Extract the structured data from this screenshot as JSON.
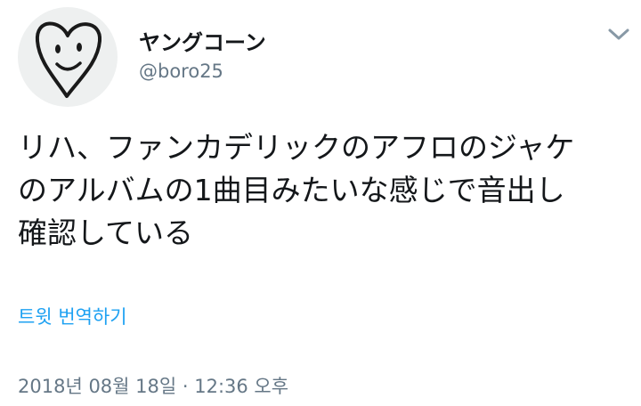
{
  "user": {
    "display_name": "ヤングコーン",
    "handle": "@boro25",
    "avatar_icon": "heart-face-avatar-icon"
  },
  "menu": {
    "icon": "chevron-down-icon"
  },
  "tweet": {
    "lines": [
      "リハ、ファンカデリックのアフロのジャケ",
      "のアルバムの1曲目みたいな感じで音出し",
      "確認している"
    ]
  },
  "translate_link": "트윗 번역하기",
  "timestamp": "2018년 08월 18일 · 12:36 오후",
  "colors": {
    "text": "#14171a",
    "secondary": "#657786",
    "link": "#1da1f2",
    "avatar_bg": "#eef0f0"
  }
}
